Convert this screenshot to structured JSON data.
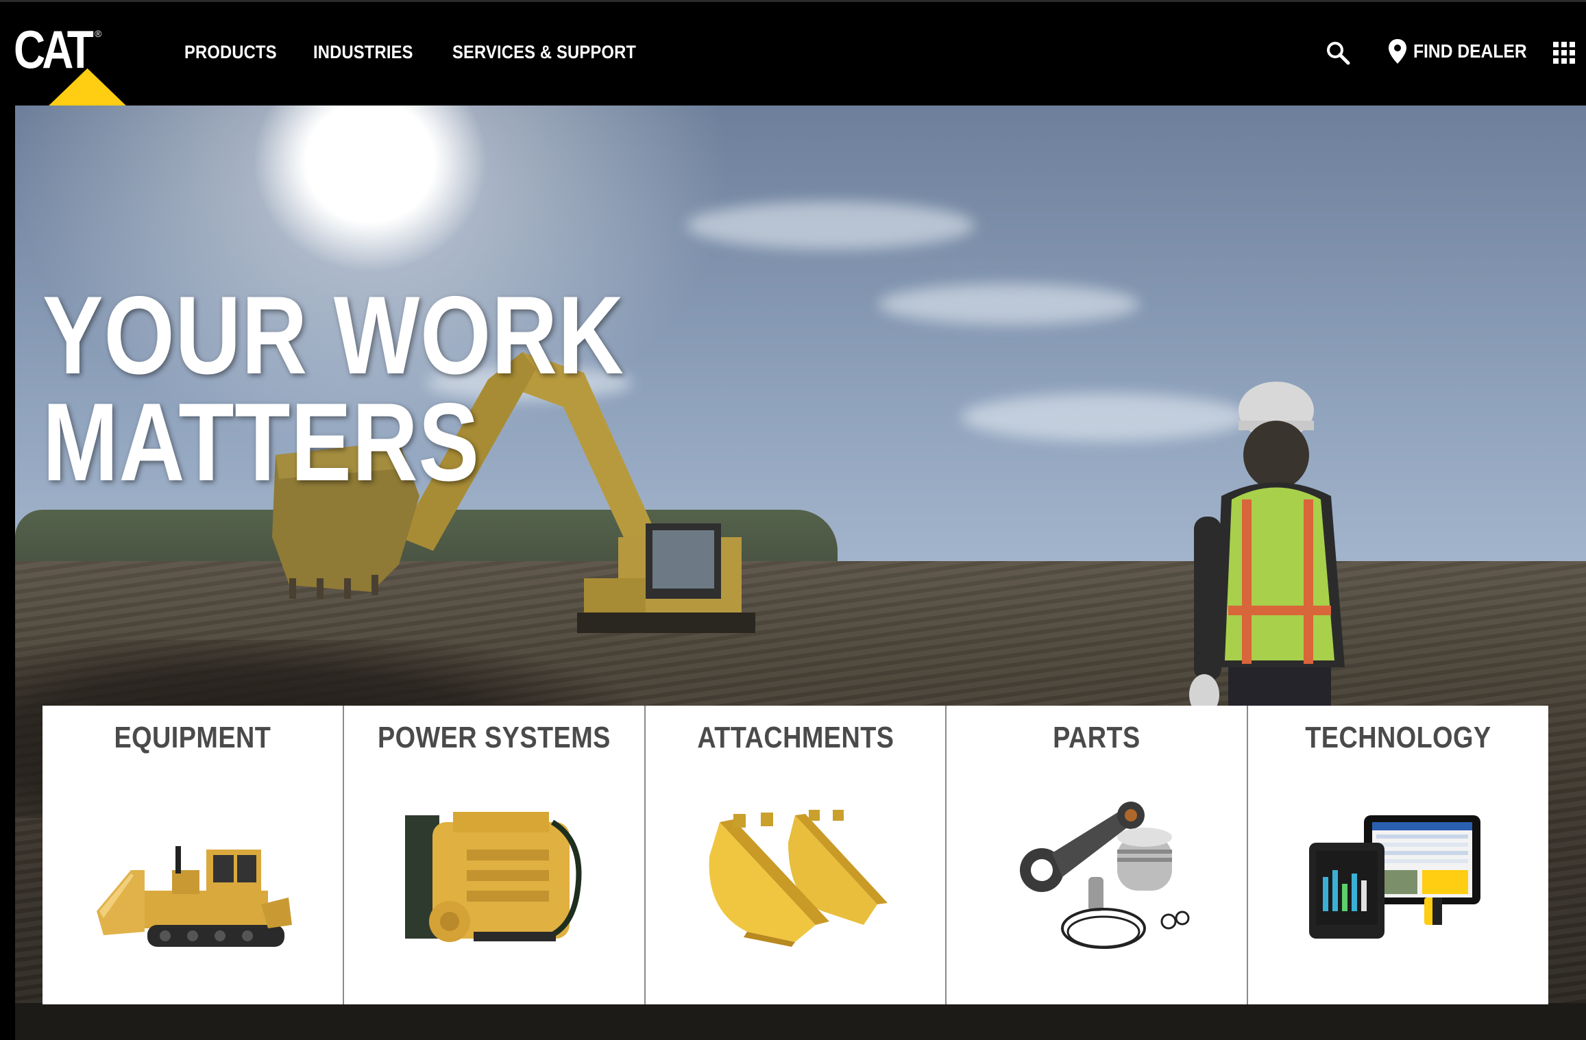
{
  "brand": {
    "logo_text": "CAT",
    "registered_mark": "®"
  },
  "nav": {
    "items": [
      {
        "label": "PRODUCTS"
      },
      {
        "label": "INDUSTRIES"
      },
      {
        "label": "SERVICES & SUPPORT"
      }
    ]
  },
  "utility": {
    "search_icon": "search-icon",
    "find_dealer_label": "FIND DEALER",
    "pin_icon": "location-pin-icon",
    "apps_icon": "grid-menu-icon"
  },
  "hero": {
    "headline_line1": "YOUR WORK",
    "headline_line2": "MATTERS"
  },
  "categories": [
    {
      "label": "EQUIPMENT",
      "image": "bulldozer"
    },
    {
      "label": "POWER SYSTEMS",
      "image": "engine"
    },
    {
      "label": "ATTACHMENTS",
      "image": "buckets"
    },
    {
      "label": "PARTS",
      "image": "piston-and-rod"
    },
    {
      "label": "TECHNOLOGY",
      "image": "tablets"
    }
  ],
  "colors": {
    "header_bg": "#000000",
    "cat_yellow": "#FFCD11",
    "card_text": "#4a4a4a",
    "card_divider": "#8a8a8a"
  }
}
